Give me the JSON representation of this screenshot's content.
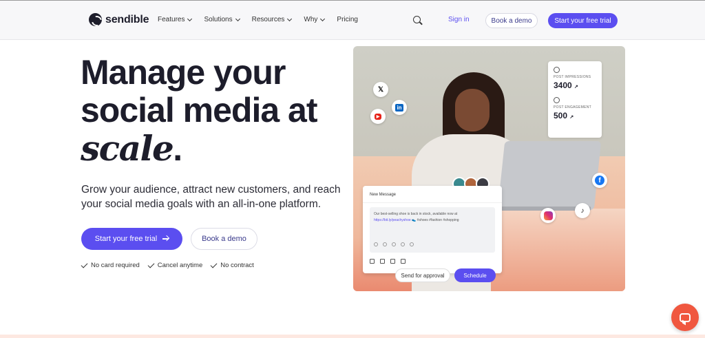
{
  "nav": {
    "brand": "sendible",
    "items": [
      {
        "label": "Features",
        "dropdown": true
      },
      {
        "label": "Solutions",
        "dropdown": true
      },
      {
        "label": "Resources",
        "dropdown": true
      },
      {
        "label": "Why",
        "dropdown": true
      },
      {
        "label": "Pricing",
        "dropdown": false
      }
    ],
    "sign_in": "Sign in",
    "book_demo": "Book a demo",
    "start_trial": "Start your free trial"
  },
  "hero": {
    "headline_1": "Manage your",
    "headline_2": "social media at",
    "headline_italic": "scale",
    "headline_end": ".",
    "subheadline": "Grow your audience, attract new customers, and reach your social media goals with an all-in-one platform.",
    "cta_primary": "Start your free trial",
    "cta_secondary": "Book a demo",
    "checks": [
      "No card required",
      "Cancel anytime",
      "No contract"
    ]
  },
  "mockup": {
    "stats": [
      {
        "label": "POST IMPRESSIONS",
        "value": "3400",
        "trend": "↗"
      },
      {
        "label": "POST ENGAGEMENT",
        "value": "500",
        "trend": "↗"
      }
    ],
    "message": {
      "title": "New Message",
      "text": "Our best-selling shoe is back in stock, available now at",
      "link": "https://bit.ly/peachyshoe",
      "tags": "👟 #shoes #fashion #shopping"
    },
    "send_for_approval": "Send for approval",
    "schedule": "Schedule"
  },
  "colors": {
    "accent": "#5b4ef0",
    "chat": "#f0573f"
  }
}
